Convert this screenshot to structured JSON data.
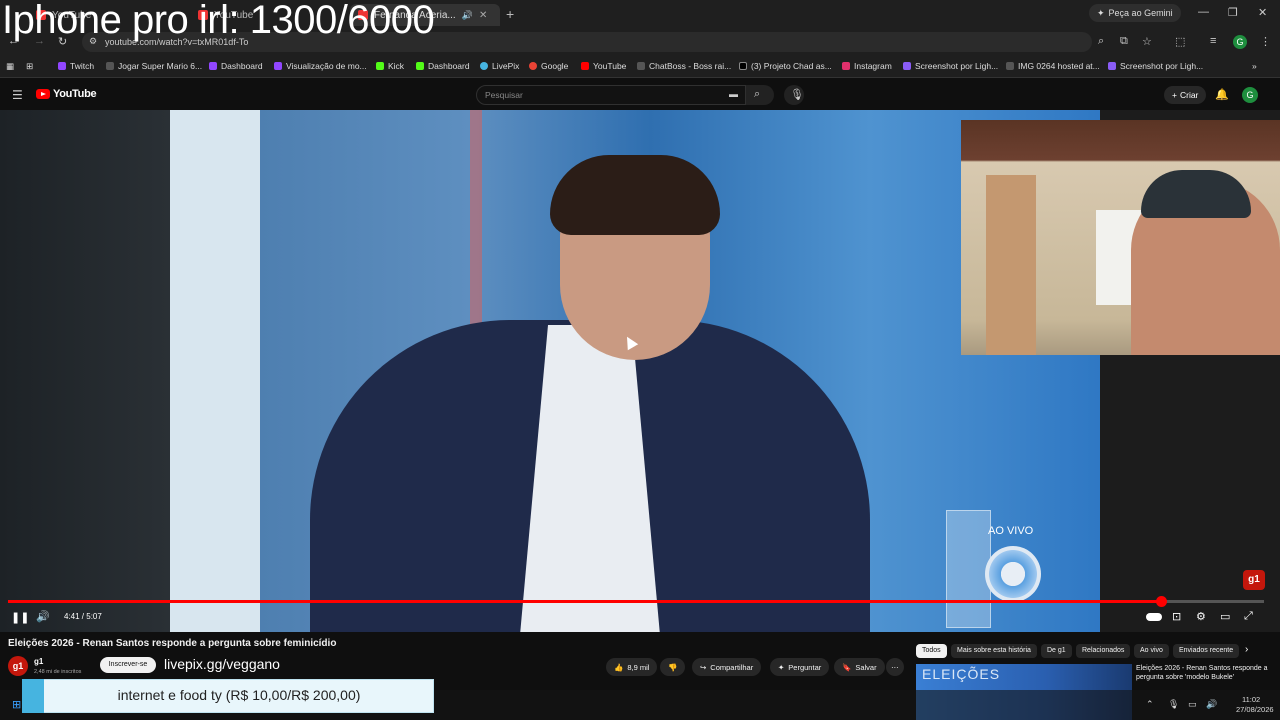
{
  "overlay": {
    "title": "Iphone pro irl: 1300/6000"
  },
  "browser": {
    "tabs": [
      {
        "label": "YouTube"
      },
      {
        "label": "YouTube"
      },
      {
        "label": "Fernanda Aceria..."
      }
    ],
    "gemini_label": "Peça ao Gemini",
    "url": "youtube.com/watch?v=txMR01df-To",
    "profile_initial": "G",
    "bookmarks": [
      {
        "label": "Twitch",
        "color": "#9146ff"
      },
      {
        "label": "Jogar Super Mario 6...",
        "color": "#555"
      },
      {
        "label": "Dashboard",
        "color": "#9146ff"
      },
      {
        "label": "Visualização de mo...",
        "color": "#9146ff"
      },
      {
        "label": "Kick",
        "color": "#53fc18"
      },
      {
        "label": "Dashboard",
        "color": "#53fc18"
      },
      {
        "label": "LivePix",
        "color": "#46b4e0"
      },
      {
        "label": "Google",
        "color": "#ea4335"
      },
      {
        "label": "YouTube",
        "color": "#ff0000"
      },
      {
        "label": "ChatBoss - Boss rai...",
        "color": "#555"
      },
      {
        "label": "(3) Projeto Chad as...",
        "color": "#000"
      },
      {
        "label": "Instagram",
        "color": "#e1306c"
      },
      {
        "label": "Screenshot por Ligh...",
        "color": "#8a5cf6"
      },
      {
        "label": "IMG 0264 hosted at...",
        "color": "#555"
      },
      {
        "label": "Screenshot por Ligh...",
        "color": "#8a5cf6"
      }
    ]
  },
  "youtube": {
    "logo_text": "YouTube",
    "search_placeholder": "Pesquisar",
    "create_label": "Criar",
    "avatar_initial": "G"
  },
  "video": {
    "ao_vivo": "AO VIVO",
    "g1_badge": "g1",
    "timecode": "4:41 / 5:07",
    "progress": 0.918,
    "title": "Eleições 2026 - Renan Santos responde a pergunta sobre feminicídio",
    "channel": {
      "name": "g1",
      "avatar": "g1",
      "subscribers": "2,48 mi de inscritos",
      "subscribe_label": "Inscrever-se"
    },
    "likes": "8,9 mil",
    "share_label": "Compartilhar",
    "ask_label": "Perguntar",
    "save_label": "Salvar"
  },
  "livepix_url": "livepix.gg/veggano",
  "chips": [
    {
      "label": "Todos"
    },
    {
      "label": "Mais sobre esta história"
    },
    {
      "label": "De g1"
    },
    {
      "label": "Relacionados"
    },
    {
      "label": "Ao vivo"
    },
    {
      "label": "Enviados recente"
    }
  ],
  "recommended": {
    "thumb_text": "ELEIÇÕES",
    "title": "Eleições 2026 - Renan Santos responde a pergunta sobre 'modelo Bukele'"
  },
  "donation": {
    "text": "internet e food ty (R$ 10,00/R$ 200,00)"
  },
  "clock": {
    "time": "11:02",
    "date": "27/08/2026"
  }
}
